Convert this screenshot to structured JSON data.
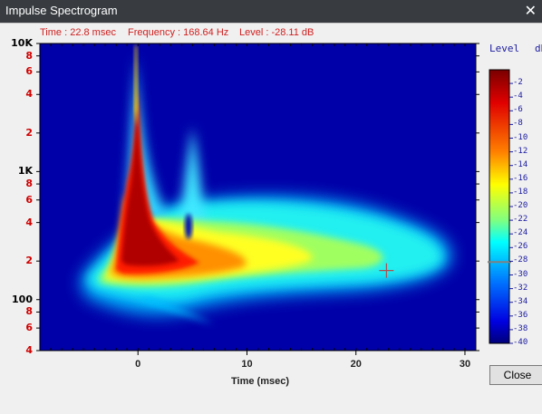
{
  "window": {
    "title": "Impulse Spectrogram"
  },
  "readout": {
    "time": "Time : 22.8 msec",
    "frequency": "Frequency : 168.64 Hz",
    "level": "Level : -28.11 dB"
  },
  "legend": {
    "title": "Level",
    "unit": "dB",
    "ticks": [
      "-2",
      "-4",
      "-6",
      "-8",
      "-10",
      "-12",
      "-14",
      "-16",
      "-18",
      "-20",
      "-22",
      "-24",
      "-26",
      "-28",
      "-30",
      "-32",
      "-34",
      "-36",
      "-38",
      "-40"
    ],
    "marker_level_db": -28.11
  },
  "close_button": {
    "label": "Close"
  },
  "chart_data": {
    "type": "heatmap",
    "title": "",
    "xlabel": "Time (msec)",
    "ylabel": "",
    "xlim": [
      -9,
      31
    ],
    "ylim_hz": [
      40,
      10000
    ],
    "y_scale": "log",
    "x_ticks": [
      "0",
      "10",
      "20",
      "30"
    ],
    "y_ticks": [
      {
        "hz": 10000,
        "label": "10K"
      },
      {
        "hz": 8000,
        "label": "8"
      },
      {
        "hz": 6000,
        "label": "6"
      },
      {
        "hz": 4000,
        "label": "4"
      },
      {
        "hz": 2000,
        "label": "2"
      },
      {
        "hz": 1000,
        "label": "1K"
      },
      {
        "hz": 800,
        "label": "8"
      },
      {
        "hz": 600,
        "label": "6"
      },
      {
        "hz": 400,
        "label": "4"
      },
      {
        "hz": 200,
        "label": "2"
      },
      {
        "hz": 100,
        "label": "100"
      },
      {
        "hz": 80,
        "label": "8"
      },
      {
        "hz": 60,
        "label": "6"
      },
      {
        "hz": 40,
        "label": "4"
      }
    ],
    "colorbar_range_db": [
      -40,
      0
    ],
    "cursor": {
      "time_ms": 22.8,
      "freq_hz": 168.64,
      "level_db": -28.11
    },
    "colors": {
      "background": "#0000a8",
      "peak": "#8b0000",
      "accent": "#d02020"
    }
  }
}
